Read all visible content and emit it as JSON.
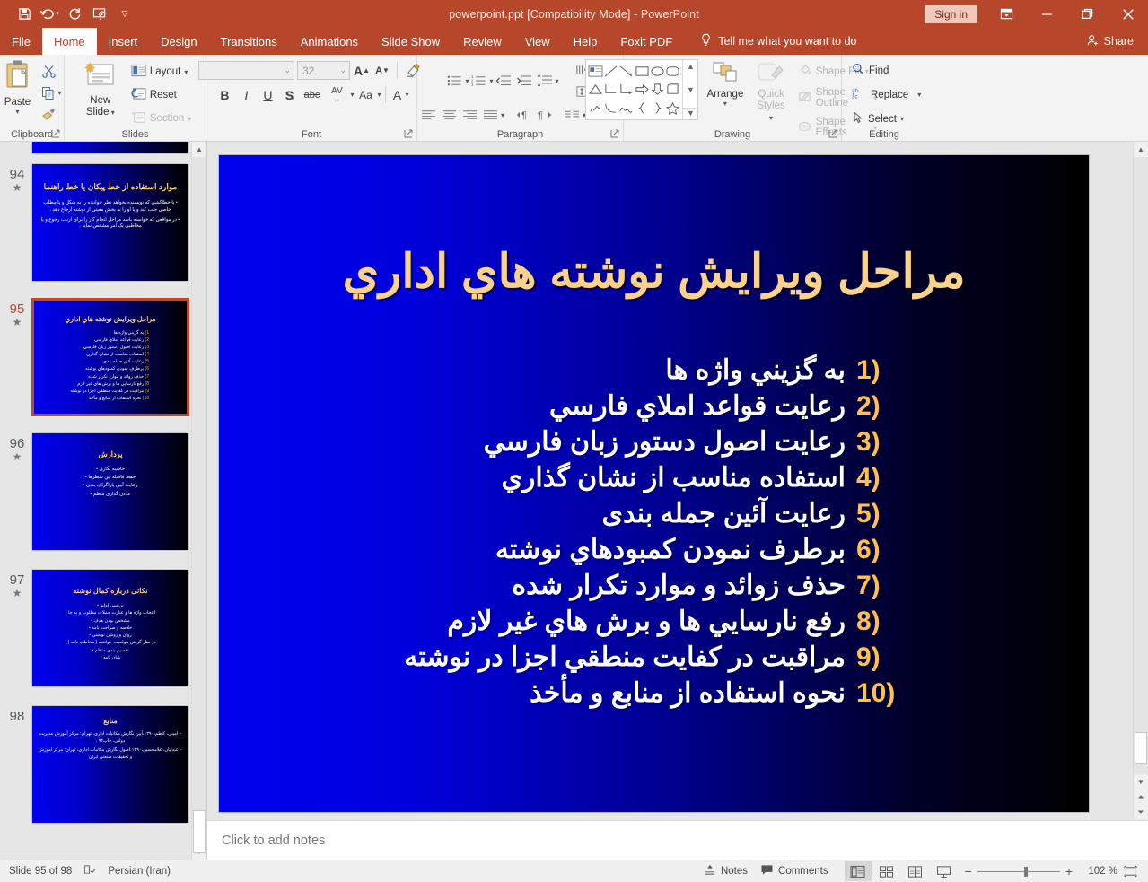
{
  "window": {
    "title": "powerpoint.ppt [Compatibility Mode]  -  PowerPoint",
    "signin_label": "Sign in",
    "minimize_icon": "minimize-icon",
    "restore_icon": "restore-icon",
    "close_icon": "close-icon",
    "ribbon_display_icon": "ribbon-display-options-icon",
    "accent_color": "#b7472a"
  },
  "quick_access": [
    {
      "name": "save-icon",
      "glyph": "save"
    },
    {
      "name": "undo-icon",
      "glyph": "undo"
    },
    {
      "name": "redo-icon",
      "glyph": "redo"
    },
    {
      "name": "start-presentation-icon",
      "glyph": "present"
    },
    {
      "name": "customize-qat-icon",
      "glyph": "chevron"
    }
  ],
  "tabs": [
    {
      "label": "File",
      "active": false
    },
    {
      "label": "Home",
      "active": true
    },
    {
      "label": "Insert",
      "active": false
    },
    {
      "label": "Design",
      "active": false
    },
    {
      "label": "Transitions",
      "active": false
    },
    {
      "label": "Animations",
      "active": false
    },
    {
      "label": "Slide Show",
      "active": false
    },
    {
      "label": "Review",
      "active": false
    },
    {
      "label": "View",
      "active": false
    },
    {
      "label": "Help",
      "active": false
    },
    {
      "label": "Foxit PDF",
      "active": false
    }
  ],
  "tellme": {
    "label": "Tell me what you want to do",
    "icon": "lightbulb-icon"
  },
  "share": {
    "label": "Share",
    "icon": "share-person-icon"
  },
  "ribbon": {
    "clipboard": {
      "label": "Clipboard",
      "paste_label": "Paste",
      "cut_label": "Cut",
      "copy_label": "Copy",
      "format_painter_label": "Format Painter"
    },
    "slides": {
      "label": "Slides",
      "new_slide_label": "New\nSlide",
      "new_slide_line1": "New",
      "new_slide_line2": "Slide",
      "layout_label": "Layout",
      "reset_label": "Reset",
      "section_label": "Section"
    },
    "font": {
      "label": "Font",
      "font_name_value": "",
      "font_name_placeholder": "",
      "font_size_value": "32",
      "bold": "B",
      "italic": "I",
      "underline": "U",
      "shadow": "S",
      "strikethrough": "abc",
      "char_spacing": "AV",
      "change_case": "Aa",
      "font_color": "A",
      "increase_size": "A",
      "decrease_size": "A",
      "clear_formatting": "clear-formatting-icon"
    },
    "paragraph": {
      "label": "Paragraph"
    },
    "drawing": {
      "label": "Drawing",
      "arrange_label": "Arrange",
      "quick_styles_line1": "Quick",
      "quick_styles_line2": "Styles",
      "shape_fill_label": "Shape Fill",
      "shape_outline_label": "Shape Outline",
      "shape_effects_label": "Shape Effects"
    },
    "editing": {
      "label": "Editing",
      "find_label": "Find",
      "replace_label": "Replace",
      "select_label": "Select"
    }
  },
  "thumbnails": [
    {
      "number": "93",
      "star": "★",
      "selected": false,
      "partial": true,
      "title": "",
      "items": []
    },
    {
      "number": "94",
      "star": "★",
      "selected": false,
      "title": "موارد استفاده از خط پیکان یا خط راهنما",
      "items": [
        "با خطاکشی که نویسنده بخواهد نظر خواننده را به شکل و یا مطلب خاصی جلب کند و یا او را به بخش معینی از نوشته ارجاع دهد .",
        "در مواقعی که خواسته باشد مراحل انجام کار را برای ارباب رجوع و یا مخاطبی یک امر مشخص نماید ."
      ]
    },
    {
      "number": "95",
      "star": "★",
      "selected": true,
      "title": "مراحل ویرایش نوشته هاي اداري",
      "items": [
        "به گزيني واژه ها",
        "رعايت قواعد املاي فارسي",
        "رعايت اصول دستور زبان فارسي",
        "استفاده مناسب از نشان گذاري",
        "رعايت آئين جمله بندی",
        "برطرف نمودن کمبودهاي نوشته",
        "حذف زوائد و موارد تکرار شده",
        "رفع نارسايي ها و برش هاي غير لازم",
        "مراقبت در کفايت منطقي اجزا در نوشته",
        "نحوه استفاده از منابع و مأخذ"
      ]
    },
    {
      "number": "96",
      "star": "★",
      "selected": false,
      "title": "پردازش",
      "items": [
        "حاشیه نگاری",
        "حفظ فاصله بین سطرها",
        "رعایت آیین پاراگراف بندی",
        "عددن گذاری منظم"
      ]
    },
    {
      "number": "97",
      "star": "★",
      "selected": false,
      "title": "نکاتی درباره کمال نوشته",
      "items": [
        "بررسی اولیه",
        "انتخاب واژه ها و عبارت جملات مطلوب و به جا",
        "مشخص بودن هدف",
        "خلاصه و صراحت نامه",
        "روان و روشن نویسی",
        "در نظر گرفتن موقعیت خواننده ( مخاطب نامه )",
        "تقسیم بندی منظم",
        "پایان نامه"
      ]
    },
    {
      "number": "98",
      "star": "",
      "selected": false,
      "title": "منابع",
      "items": [
        "امینی، کاظم،۱۳۹۰،آیین نگارش مکاتبات اداری، تهران: مرکز آموزش مدیریت دولتی، چاپ۹۴ .",
        "عبدلیان، غلامحسین،۱۳۹۰،اصول نگارش مکاتبات اداری، تهران: مرکز آموزش و تحقیقات صنعتی ایران"
      ]
    }
  ],
  "slide": {
    "title": "مراحل ویرایش نوشته هاي اداري",
    "items": [
      {
        "num": "1)",
        "text": "به گزيني واژه ها"
      },
      {
        "num": "2)",
        "text": "رعايت قواعد املاي فارسي"
      },
      {
        "num": "3)",
        "text": "رعايت اصول دستور زبان فارسي"
      },
      {
        "num": "4)",
        "text": "استفاده مناسب از نشان گذاري"
      },
      {
        "num": "5)",
        "text": "رعايت آئين جمله بندی"
      },
      {
        "num": "6)",
        "text": "برطرف نمودن کمبودهاي نوشته"
      },
      {
        "num": "7)",
        "text": "حذف زوائد و موارد تکرار شده"
      },
      {
        "num": "8)",
        "text": "رفع نارسايي ها و برش هاي غير لازم"
      },
      {
        "num": "9)",
        "text": "مراقبت در کفايت منطقي اجزا در نوشته"
      },
      {
        "num": "10)",
        "text": "نحوه استفاده از منابع و مأخذ"
      }
    ],
    "bg_left_color": "#0000ee",
    "bg_right_color": "#000000",
    "title_color": "#fbd28a",
    "number_color": "#ffc04d",
    "text_color": "#ffffff"
  },
  "notes": {
    "placeholder": "Click to add notes"
  },
  "status": {
    "slide_counter": "Slide 95 of 98",
    "language": "Persian (Iran)",
    "spellcheck_icon": "spellcheck-icon",
    "notes_label": "Notes",
    "comments_label": "Comments",
    "zoom_percent": "102 %",
    "views": [
      {
        "name": "normal-view-button",
        "active": true
      },
      {
        "name": "slide-sorter-view-button",
        "active": false
      },
      {
        "name": "reading-view-button",
        "active": false
      },
      {
        "name": "slideshow-view-button",
        "active": false
      }
    ],
    "zoom_out": "−",
    "zoom_in": "+",
    "fit_slide_icon": "fit-slide-to-window-icon"
  }
}
